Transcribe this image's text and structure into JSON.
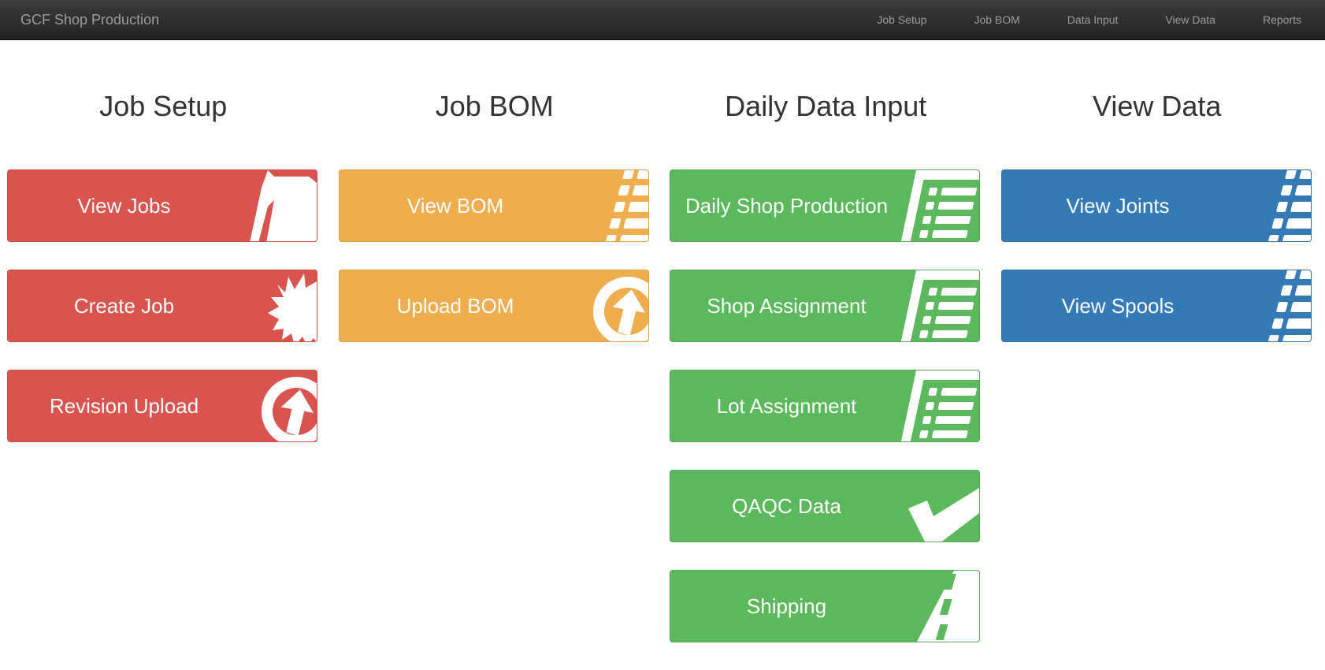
{
  "app": {
    "brand": "GCF Shop Production"
  },
  "nav": {
    "items": [
      {
        "label": "Job Setup"
      },
      {
        "label": "Job BOM"
      },
      {
        "label": "Data Input"
      },
      {
        "label": "View Data"
      },
      {
        "label": "Reports"
      }
    ]
  },
  "colors": {
    "red": "#d9534f",
    "orange": "#f0ad4e",
    "green": "#5cb85c",
    "blue": "#337ab7",
    "navbar": "#222222"
  },
  "sections": [
    {
      "title": "Job Setup",
      "color": "red",
      "buttons": [
        {
          "label": "View Jobs",
          "icon": "folder-open-icon"
        },
        {
          "label": "Create Job",
          "icon": "starburst-icon"
        },
        {
          "label": "Revision Upload",
          "icon": "upload-circle-icon"
        }
      ]
    },
    {
      "title": "Job BOM",
      "color": "orange",
      "buttons": [
        {
          "label": "View BOM",
          "icon": "list-icon"
        },
        {
          "label": "Upload BOM",
          "icon": "upload-circle-icon"
        }
      ]
    },
    {
      "title": "Daily Data Input",
      "color": "green",
      "buttons": [
        {
          "label": "Daily Shop Production",
          "icon": "list-alt-icon"
        },
        {
          "label": "Shop Assignment",
          "icon": "list-alt-icon"
        },
        {
          "label": "Lot Assignment",
          "icon": "list-alt-icon"
        },
        {
          "label": "QAQC Data",
          "icon": "checkmark-icon"
        },
        {
          "label": "Shipping",
          "icon": "road-icon"
        }
      ]
    },
    {
      "title": "View Data",
      "color": "blue",
      "buttons": [
        {
          "label": "View Joints",
          "icon": "list-icon"
        },
        {
          "label": "View Spools",
          "icon": "list-icon"
        }
      ]
    }
  ]
}
